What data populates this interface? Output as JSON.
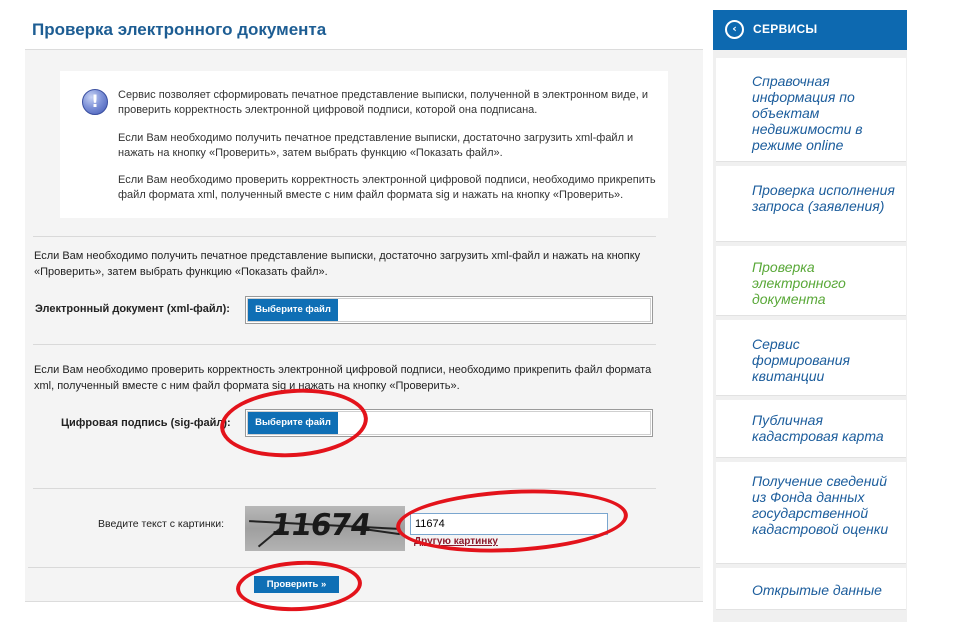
{
  "page": {
    "title": "Проверка электронного документа"
  },
  "info": {
    "p1": "Сервис позволяет сформировать печатное представление выписки, полученной в электронном виде, и проверить корректность электронной цифровой подписи, которой она подписана.",
    "p2": "Если Вам необходимо получить печатное представление выписки, достаточно загрузить xml-файл и нажать на кнопку «Проверить», затем выбрать функцию «Показать файл».",
    "p3": "Если Вам необходимо проверить корректность электронной цифровой подписи, необходимо прикрепить файл формата xml, полученный вместе с ним файл формата sig и нажать на кнопку «Проверить»."
  },
  "xml_section": {
    "text": "Если Вам необходимо получить печатное представление выписки, достаточно загрузить xml-файл и нажать на кнопку «Проверить», затем выбрать функцию «Показать файл».",
    "label": "Электронный документ (xml-файл):",
    "button": "Выберите файл"
  },
  "sig_section": {
    "text": "Если Вам необходимо проверить корректность электронной цифровой подписи, необходимо прикрепить файл формата xml, полученный вместе с ним файл формата sig и нажать на кнопку «Проверить».",
    "label": "Цифровая подпись (sig-файл):",
    "button": "Выберите файл"
  },
  "captcha": {
    "label": "Введите текст с картинки:",
    "image_text": "11674",
    "input_value": "11674",
    "refresh_link": "Другую картинку"
  },
  "submit": {
    "label": "Проверить »"
  },
  "sidebar": {
    "title": "СЕРВИСЫ",
    "items": [
      {
        "label": "Справочная информация по объектам недвижимости в режиме online",
        "active": false
      },
      {
        "label": "Проверка исполнения запроса (заявления)",
        "active": false
      },
      {
        "label": "Проверка электронного документа",
        "active": true
      },
      {
        "label": "Сервис формирования квитанции",
        "active": false
      },
      {
        "label": "Публичная кадастровая карта",
        "active": false
      },
      {
        "label": "Получение сведений из Фонда данных государственной кадастровой оценки",
        "active": false
      },
      {
        "label": "Открытые данные",
        "active": false
      }
    ]
  },
  "colors": {
    "accent": "#0d69b0",
    "title": "#1d5d93",
    "active_link": "#59a838",
    "highlight_ring": "#e3131b"
  }
}
